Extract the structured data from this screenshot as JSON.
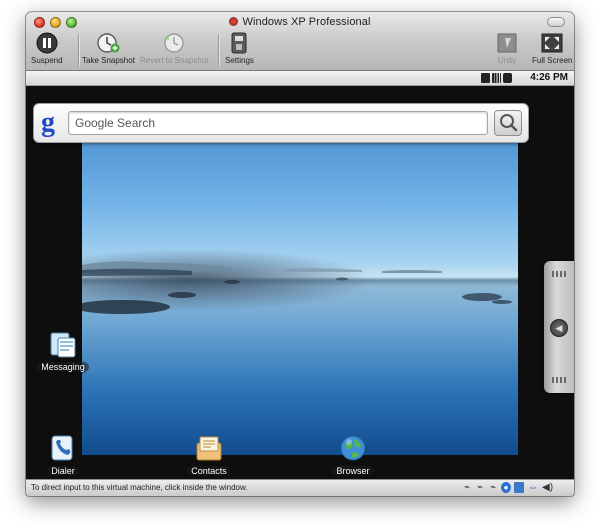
{
  "window": {
    "title": "Windows XP Professional"
  },
  "toolbar": {
    "suspend_label": "Suspend",
    "snapshot_label": "Take Snapshot",
    "revert_label": "Revert to Snapshot",
    "settings_label": "Settings",
    "unity_label": "Unity",
    "fullscreen_label": "Full Screen"
  },
  "android_status": {
    "time": "4:26 PM"
  },
  "search": {
    "placeholder": "Google Search",
    "logo": "g"
  },
  "apps": {
    "messaging": "Messaging",
    "dialer": "Dialer",
    "contacts": "Contacts",
    "browser": "Browser"
  },
  "drawer": {
    "arrow": "◀"
  },
  "bottom_bar": {
    "message": "To direct input to this virtual machine, click inside the window."
  },
  "colors": {
    "google_blue": "#1d49c2",
    "wallpaper_sky": "#75b5e8",
    "wallpaper_water": "#114c8e"
  }
}
